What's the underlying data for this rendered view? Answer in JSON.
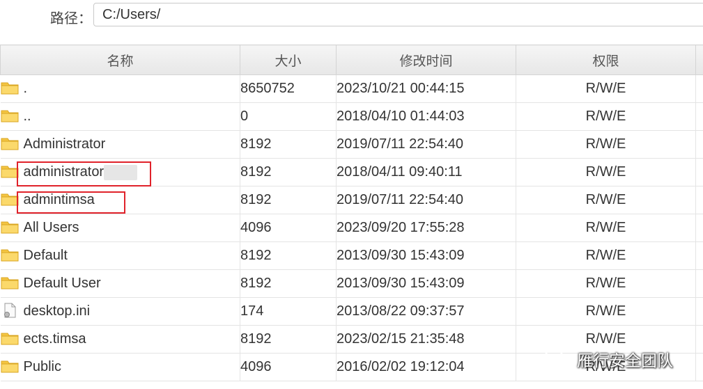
{
  "path": {
    "label": "路径：",
    "value": "C:/Users/"
  },
  "columns": [
    "名称",
    "大小",
    "修改时间",
    "权限"
  ],
  "rows": [
    {
      "icon": "folder-icon",
      "name": ".",
      "size": "8650752",
      "mtime": "2023/10/21 00:44:15",
      "perm": "R/W/E"
    },
    {
      "icon": "folder-icon",
      "name": "..",
      "size": "0",
      "mtime": "2018/04/10 01:44:03",
      "perm": "R/W/E"
    },
    {
      "icon": "folder-icon",
      "name": "Administrator",
      "size": "8192",
      "mtime": "2019/07/11 22:54:40",
      "perm": "R/W/E"
    },
    {
      "icon": "folder-icon",
      "name": "administrator",
      "size": "8192",
      "mtime": "2018/04/11 09:40:11",
      "perm": "R/W/E",
      "redacted": true,
      "highlighted": true
    },
    {
      "icon": "folder-icon",
      "name": "admintimsa",
      "size": "8192",
      "mtime": "2019/07/11 22:54:40",
      "perm": "R/W/E",
      "highlighted": true
    },
    {
      "icon": "folder-icon",
      "name": "All Users",
      "size": "4096",
      "mtime": "2023/09/20 17:55:28",
      "perm": "R/W/E"
    },
    {
      "icon": "folder-icon",
      "name": "Default",
      "size": "8192",
      "mtime": "2013/09/30 15:43:09",
      "perm": "R/W/E"
    },
    {
      "icon": "folder-icon",
      "name": "Default User",
      "size": "8192",
      "mtime": "2013/09/30 15:43:09",
      "perm": "R/W/E"
    },
    {
      "icon": "file-icon",
      "name": "desktop.ini",
      "size": "174",
      "mtime": "2013/08/22 09:37:57",
      "perm": "R/W/E"
    },
    {
      "icon": "folder-icon",
      "name": "ects.timsa",
      "size": "8192",
      "mtime": "2023/02/15 21:35:48",
      "perm": "R/W/E"
    },
    {
      "icon": "folder-icon",
      "name": "Public",
      "size": "4096",
      "mtime": "2016/02/02 19:12:04",
      "perm": "R/W/E"
    }
  ],
  "watermark": {
    "icon": "wechat-icon",
    "text": "雁行安全团队"
  },
  "colors": {
    "highlight": "#e0222a",
    "folder": "#f4c542"
  }
}
